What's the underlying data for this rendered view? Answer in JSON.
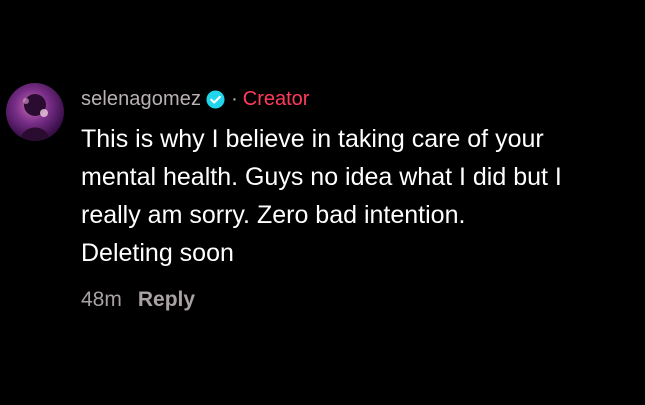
{
  "comment": {
    "avatar_icon": "user-avatar",
    "username": "selenagomez",
    "verified_icon": "verified-badge-icon",
    "separator": "·",
    "role_label": "Creator",
    "text_lines": [
      "This is why I believe in taking care of your",
      "mental health. Guys no idea what I did but I",
      "really am sorry. Zero bad intention.",
      "Deleting soon"
    ],
    "time": "48m",
    "reply_label": "Reply"
  },
  "colors": {
    "background": "#000000",
    "username": "#b9b1b3",
    "creator": "#ff3b5c",
    "verified_badge": "#20d5ec",
    "body_text": "#ffffff",
    "meta_text": "#a9a2a4"
  }
}
